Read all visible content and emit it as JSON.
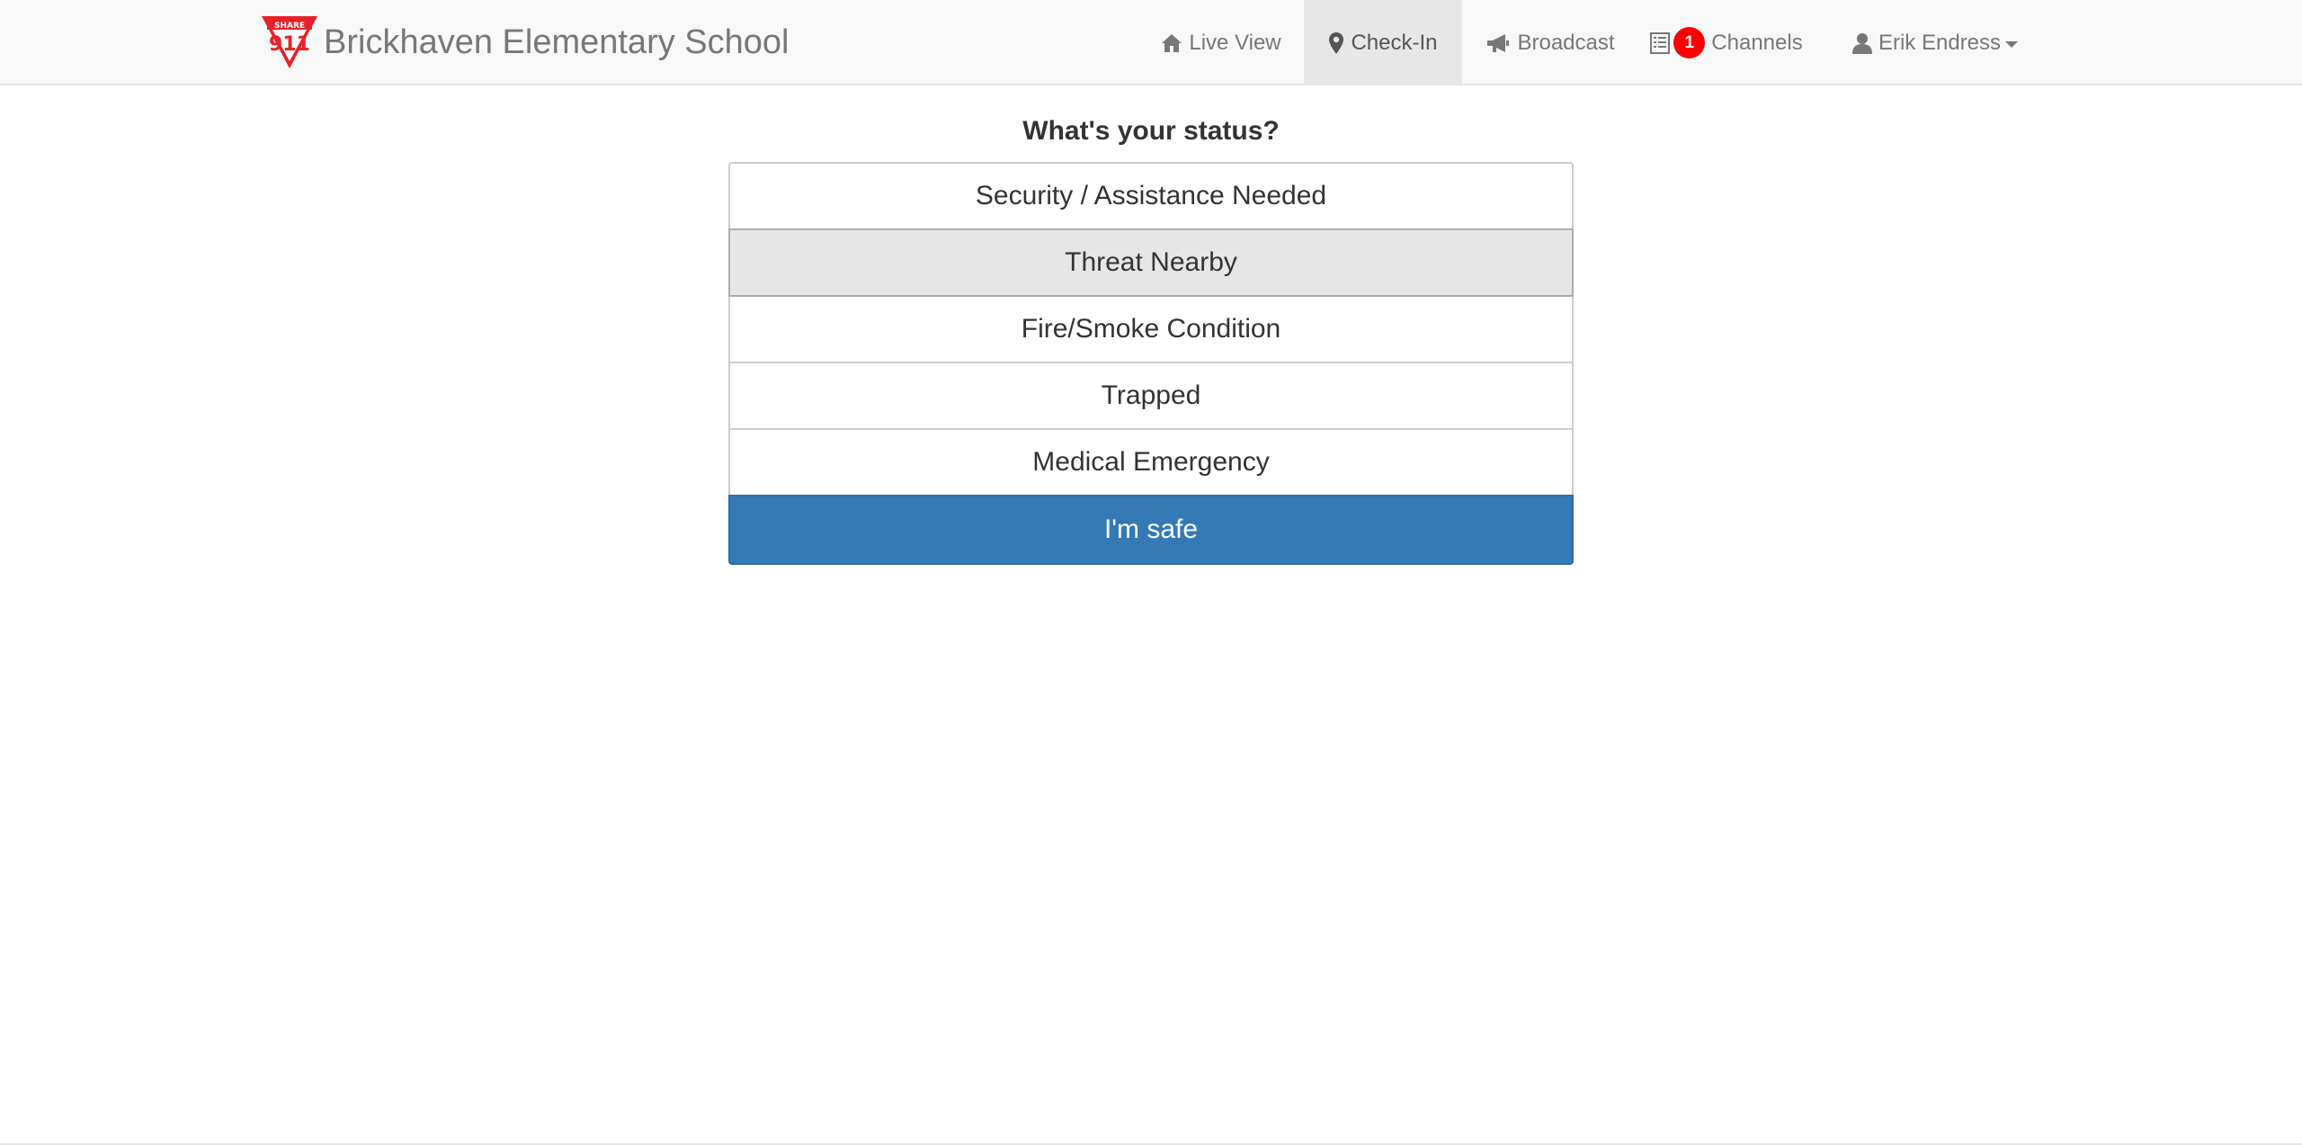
{
  "app": {
    "logo_icon": "share911-logo-icon",
    "title": "Brickhaven Elementary School"
  },
  "nav": {
    "live_view": {
      "label": "Live View",
      "icon": "home-icon"
    },
    "check_in": {
      "label": "Check-In",
      "icon": "map-marker-icon",
      "active": true
    },
    "broadcast": {
      "label": "Broadcast",
      "icon": "bullhorn-icon"
    },
    "channels": {
      "label": "Channels",
      "icon": "list-alt-icon",
      "badge": "1"
    },
    "user": {
      "label": "Erik Endress",
      "icon": "user-icon",
      "has_dropdown": true
    }
  },
  "status": {
    "question": "What's your status?",
    "options": [
      {
        "label": "Security / Assistance Needed"
      },
      {
        "label": "Threat Nearby",
        "state": "hover"
      },
      {
        "label": "Fire/Smoke Condition"
      },
      {
        "label": "Trapped"
      },
      {
        "label": "Medical Emergency"
      },
      {
        "label": "I'm safe",
        "style": "primary"
      }
    ]
  },
  "colors": {
    "navbar_bg": "#f8f8f8",
    "active_tab_bg": "#e7e7e7",
    "primary": "#337ab7",
    "badge": "#ff0000",
    "logo_red": "#e8202a"
  }
}
